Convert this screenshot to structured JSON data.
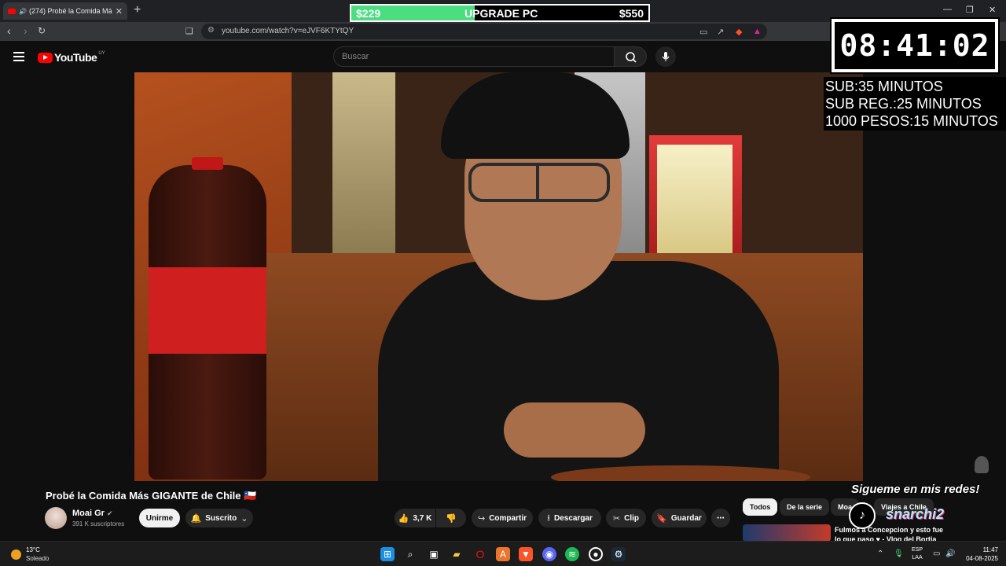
{
  "browser": {
    "tab_title": "(274) Probé la Comida Más G",
    "url": "youtube.com/watch?v=eJVF6KTYtQY",
    "new_tab": "+",
    "close": "✕"
  },
  "upgrade_bar": {
    "current": "$229",
    "label": "UPGRADE PC",
    "goal": "$550",
    "progress": 0.416
  },
  "youtube": {
    "logo_text": "YouTube",
    "region": "UY",
    "search_placeholder": "Buscar"
  },
  "timer": {
    "value": "08:41:02"
  },
  "rules": [
    "SUB:35 MINUTOS",
    "SUB REG.:25 MINUTOS",
    "1000 PESOS:15 MINUTOS"
  ],
  "video": {
    "title": "Probé la Comida Más GIGANTE de Chile 🇨🇱",
    "channel": "Moai Gr",
    "subscribers": "391 K suscriptores",
    "join_label": "Unirme",
    "subscribed_label": "Suscrito",
    "likes": "3,7 K",
    "share_label": "Compartir",
    "download_label": "Descargar",
    "clip_label": "Clip",
    "save_label": "Guardar",
    "more_label": "⋯"
  },
  "chips": [
    "Todos",
    "De la serie",
    "Moa",
    "Viajes a Chile"
  ],
  "recommendation": {
    "title": "Fulmos a Concepcion y esto fue lo que paso ♥ - Vlog del Bortia"
  },
  "overlay": {
    "follow_text": "Sigueme en mis redes!",
    "handle": "snarchi2"
  },
  "taskbar": {
    "temperature": "13°C",
    "weather": "Soleado",
    "lang1": "ESP",
    "lang2": "LAA",
    "time": "11:47",
    "date": "04-08-2025"
  }
}
